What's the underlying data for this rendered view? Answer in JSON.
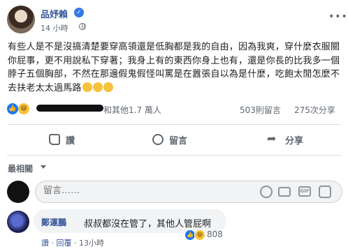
{
  "post": {
    "author": "品妤賴",
    "time": "14 小時",
    "text": "有些人是不是沒搞清楚要穿高領還是低胸都是我的自由，因為我爽，穿什麼衣服關你屁事，更不用說私下穿著；我身上有的東西你身上也有，還是你長的比我多一個脖子五個胸部，不然在那邊假鬼假怪叫罵是在囂張自以為是什麼，吃飽太閒怎麼不去扶老太太過馬路",
    "reaction_summary": "和其他1.7 萬人",
    "comment_count": "503則留言",
    "share_count": "275次分享"
  },
  "actions": {
    "like": "讚",
    "comment": "留言",
    "share": "分享"
  },
  "sort": {
    "label": "最相關"
  },
  "composer": {
    "placeholder": "留言……",
    "gif": "GIF"
  },
  "comment": {
    "author": "鄭運鵬",
    "text": "叔叔都沒在管了，其他人管屁啊",
    "reaction_count": "808",
    "like_label": "讚",
    "reply_label": "回覆",
    "time": "13小時"
  },
  "colors": {
    "link_blue": "#385898",
    "facebook_blue": "#1877f2",
    "muted_gray": "#606770"
  },
  "icons": [
    "verified-badge-icon",
    "globe-icon",
    "more-options-icon",
    "like-reaction-icon",
    "haha-reaction-icon",
    "thumbs-up-icon",
    "comment-bubble-icon",
    "share-arrow-icon",
    "dropdown-caret-icon",
    "emoji-icon",
    "camera-icon",
    "gif-icon",
    "sticker-icon"
  ]
}
